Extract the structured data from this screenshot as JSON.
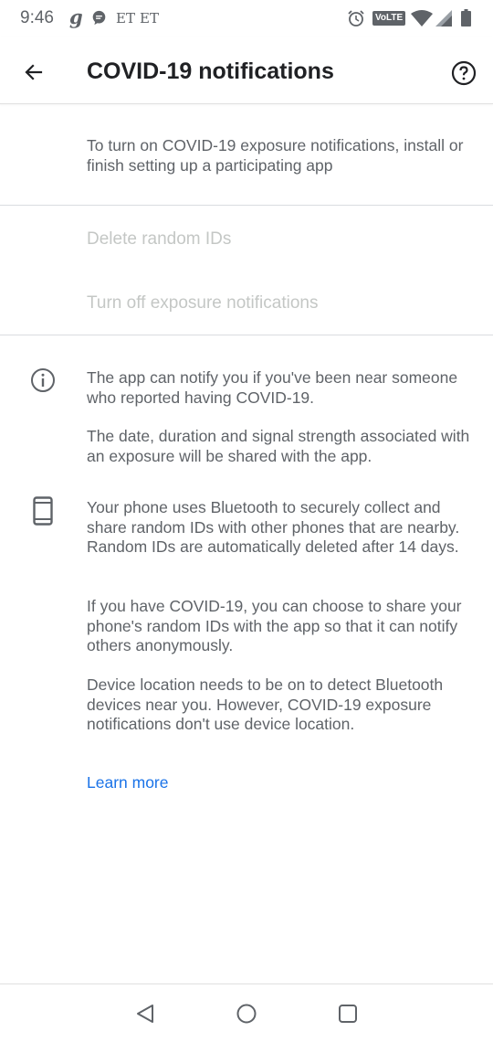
{
  "status_bar": {
    "time": "9:46",
    "carrier_glyph": "g",
    "et1": "ET",
    "et2": "ET",
    "volte": "VoLTE",
    "icons": [
      "messenger-icon",
      "alarm-icon",
      "wifi-icon",
      "signal-icon",
      "battery-icon"
    ]
  },
  "app_bar": {
    "title": "COVID-19 notifications",
    "icons": [
      "back-arrow-icon",
      "help-circle-icon"
    ]
  },
  "intro": {
    "text": "To turn on COVID-19 exposure notifications, install or finish setting up a participating app"
  },
  "actions": {
    "delete_ids": "Delete random IDs",
    "turn_off": "Turn off exposure notifications"
  },
  "info": {
    "notify_text": "The app can notify you if you've been near someone who reported having COVID-19.",
    "shared_text": "The date, duration and signal strength associated with an exposure will be shared with the app.",
    "bluetooth_text": "Your phone uses Bluetooth to securely collect and share random IDs with other phones that are nearby. Random IDs are automatically deleted after 14 days.",
    "share_text": "If you have COVID-19, you can choose to share your phone's random IDs with the app so that it can notify others anonymously.",
    "location_text": "Device location needs to be on to detect Bluetooth devices near you. However, COVID-19 exposure notifications don't use device location.",
    "icons": [
      "info-icon",
      "phone-icon"
    ]
  },
  "learn_more": "Learn more",
  "colors": {
    "link": "#1a73e8",
    "title": "#202124",
    "body_text": "#5f6368",
    "disabled_text": "#c4c7c5"
  }
}
